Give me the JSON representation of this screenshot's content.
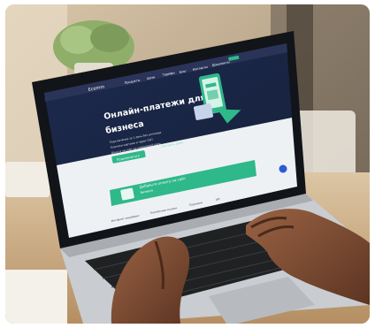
{
  "screen": {
    "logo": "Ecomm",
    "nav_items": [
      "Продукты",
      "Цены",
      "Тарифы",
      "Блог",
      "Контакты",
      "Документы"
    ],
    "hero": {
      "title_line1": "Онлайн-платежи для",
      "title_line2": "бизнеса",
      "bullets": [
        "Подключение за 1 день без договора",
        "Платежи картами и через СБП",
        "Деньги на счёт на следующий день"
      ],
      "cta_label": "Подключиться",
      "link_label": "Смотреть демо"
    },
    "promo": {
      "text_line1": "Добавьте оплату на сайт",
      "text_line2": "бизнеса"
    },
    "cards": [
      "Интернет-эквайринг",
      "Платёжные ссылки",
      "Подписки",
      "API"
    ]
  },
  "colors": {
    "screen_bg": "#1b2646",
    "accent_green": "#2fb88a",
    "laptop_body": "#c9ccd0",
    "keyboard": "#1f2123",
    "table_wood": "#c9a77c"
  }
}
